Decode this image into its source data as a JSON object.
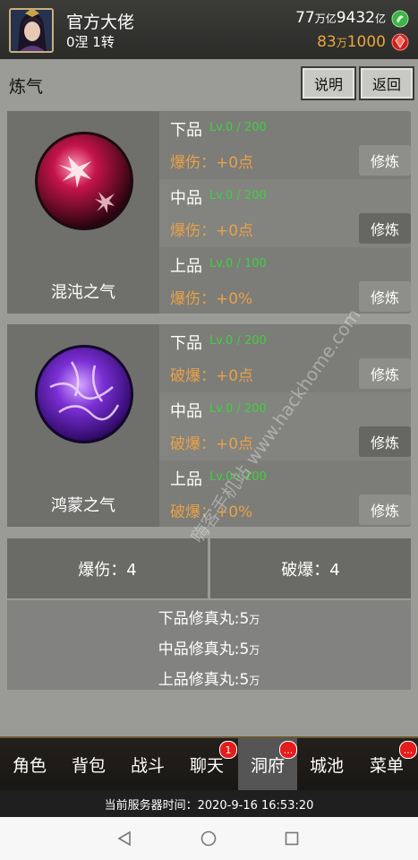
{
  "header": {
    "player_name": "官方大佬",
    "rank": "0涅 1转",
    "currency1": {
      "a": "77",
      "a_unit": "万亿",
      "b": "9432",
      "b_unit": "亿"
    },
    "currency2": {
      "a": "83",
      "a_unit": "万",
      "b": "1000"
    }
  },
  "titlebar": {
    "title": "炼气",
    "explain": "说明",
    "back": "返回"
  },
  "sections": [
    {
      "name": "混沌之气",
      "rows": [
        {
          "grade": "下品",
          "lv": "Lv.0 / 200",
          "stat": "爆伤：+0点",
          "btn": "修炼"
        },
        {
          "grade": "中品",
          "lv": "Lv.0 / 200",
          "stat": "爆伤：+0点",
          "btn": "修炼"
        },
        {
          "grade": "上品",
          "lv": "Lv.0 / 100",
          "stat": "爆伤：+0%",
          "btn": "修炼"
        }
      ]
    },
    {
      "name": "鸿蒙之气",
      "rows": [
        {
          "grade": "下品",
          "lv": "Lv.0 / 200",
          "stat": "破爆：+0点",
          "btn": "修炼"
        },
        {
          "grade": "中品",
          "lv": "Lv.0 / 200",
          "stat": "破爆：+0点",
          "btn": "修炼"
        },
        {
          "grade": "上品",
          "lv": "Lv.0 / 100",
          "stat": "破爆：+0%",
          "btn": "修炼"
        }
      ]
    }
  ],
  "summary": {
    "left": "爆伤：4",
    "right": "破爆：4"
  },
  "pills": [
    {
      "label": "下品修真丸:5",
      "unit": "万"
    },
    {
      "label": "中品修真丸:5",
      "unit": "万"
    },
    {
      "label": "上品修真丸:5",
      "unit": "万"
    }
  ],
  "nav": [
    {
      "label": "角色"
    },
    {
      "label": "背包"
    },
    {
      "label": "战斗"
    },
    {
      "label": "聊天",
      "badge": "1"
    },
    {
      "label": "洞府",
      "badge": "..."
    },
    {
      "label": "城池"
    },
    {
      "label": "菜单",
      "badge": "..."
    }
  ],
  "server_time": "当前服务器时间：2020-9-16 16:53:20",
  "watermark": "嗨客手机站 www.hackhome.com",
  "colors": {
    "green_level": "#3fd13f",
    "orange_stat": "#e7a247",
    "badge_red": "#e31c1c"
  }
}
